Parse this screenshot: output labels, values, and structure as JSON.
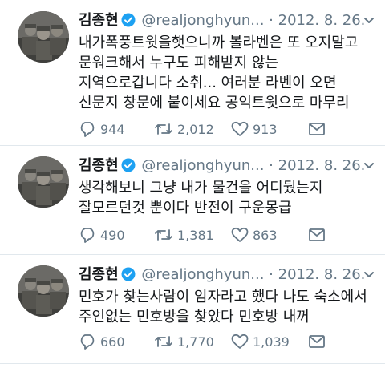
{
  "tweets": [
    {
      "name": "김종현",
      "handle": "@realjonghyun...",
      "separator": "·",
      "date": "2012. 8. 26.",
      "lines": [
        "내가폭풍트윗을햇으니까 볼라벤은 또 오지말고",
        "문워크해서 누구도 피해받지 않는",
        "지역으로갑니다 소취... 여러분 라벤이 오면",
        "신문지 창문에 붙이세요 공익트윗으로 마무리"
      ],
      "replies": "944",
      "retweets": "2,012",
      "likes": "913"
    },
    {
      "name": "김종현",
      "handle": "@realjonghyun...",
      "separator": "·",
      "date": "2012. 8. 26.",
      "lines": [
        "생각해보니 그냥 내가 물건을 어디뒀는지",
        "잘모르던것 뿐이다 반전이 구운몽급"
      ],
      "replies": "490",
      "retweets": "1,381",
      "likes": "863"
    },
    {
      "name": "김종현",
      "handle": "@realjonghyun...",
      "separator": "·",
      "date": "2012. 8. 26.",
      "lines": [
        "민호가 찾는사람이 임자라고 했다 나도 숙소에서",
        "주인없는 민호방을 찾았다 민호방 내꺼"
      ],
      "replies": "660",
      "retweets": "1,770",
      "likes": "1,039"
    }
  ],
  "icons": {
    "verified": "verified-badge-icon",
    "menu": "chevron-down-icon",
    "reply": "reply-icon",
    "retweet": "retweet-icon",
    "like": "heart-icon",
    "message": "direct-message-icon"
  },
  "colors": {
    "text": "#14171a",
    "secondary": "#657786",
    "verified": "#1da1f2",
    "divider": "#e1e8ed"
  }
}
